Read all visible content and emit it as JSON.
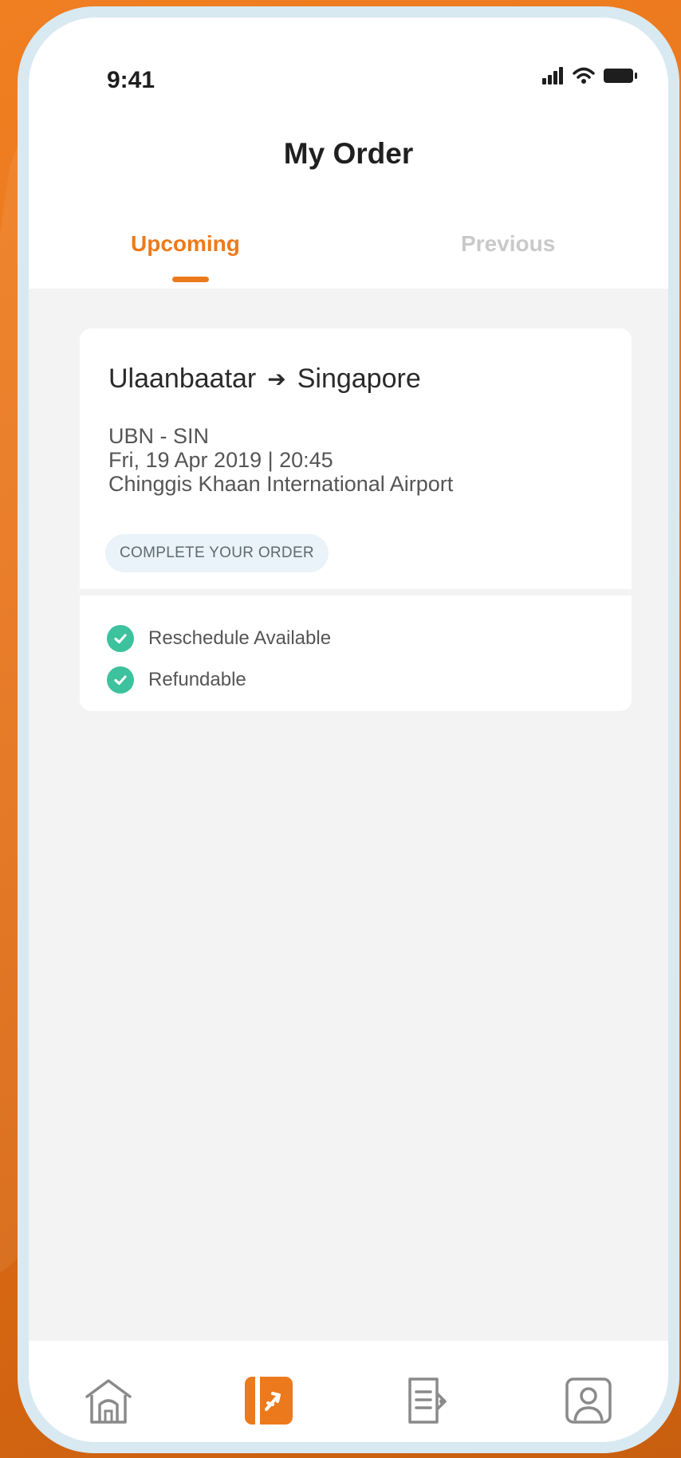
{
  "status_bar": {
    "time": "9:41",
    "icons": [
      "signal-icon",
      "wifi-icon",
      "battery-icon"
    ]
  },
  "header": {
    "title": "My Order"
  },
  "tabs": [
    {
      "label": "Upcoming",
      "active": true
    },
    {
      "label": "Previous",
      "active": false
    }
  ],
  "order": {
    "origin": "Ulaanbaatar",
    "destination": "Singapore",
    "arrow": "➔",
    "codes": "UBN - SIN",
    "datetime": "Fri, 19 Apr 2019 | 20:45",
    "airport": "Chinggis Khaan International Airport",
    "action_label": "COMPLETE YOUR ORDER",
    "features": [
      "Reschedule Available",
      "Refundable"
    ]
  },
  "bottom_nav": [
    {
      "name": "home-icon",
      "active": false
    },
    {
      "name": "orders-icon",
      "active": true
    },
    {
      "name": "bookings-icon",
      "active": false
    },
    {
      "name": "profile-icon",
      "active": false
    }
  ],
  "colors": {
    "accent": "#ec7a1c",
    "check": "#3cc29c",
    "inactive": "#c9c9c9",
    "background": "#e8741a"
  }
}
